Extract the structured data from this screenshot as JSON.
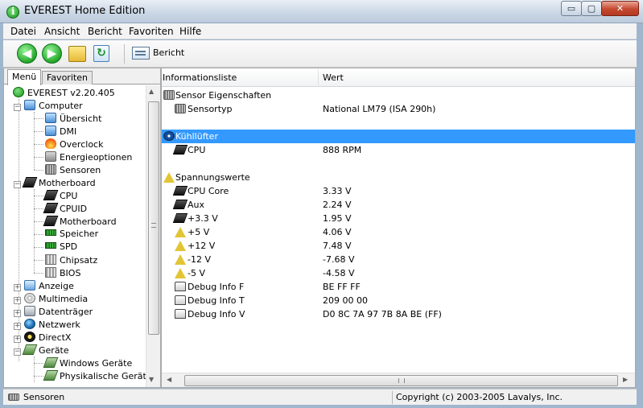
{
  "window": {
    "title": "EVEREST Home Edition",
    "min_glyph": "▭",
    "max_glyph": "▢",
    "close_glyph": "✕"
  },
  "menu": [
    "Datei",
    "Ansicht",
    "Bericht",
    "Favoriten",
    "Hilfe"
  ],
  "toolbar": {
    "back_glyph": "◀",
    "forward_glyph": "▶",
    "refresh_glyph": "↻",
    "report_label": "Bericht"
  },
  "left_tabs": [
    "Menü",
    "Favoriten"
  ],
  "tree": [
    {
      "label": "EVEREST v2.20.405",
      "icon": "everest-icon"
    },
    {
      "label": "Computer",
      "icon": "computer-icon"
    },
    {
      "label": "Übersicht",
      "icon": "computer-icon"
    },
    {
      "label": "DMI",
      "icon": "computer-icon"
    },
    {
      "label": "Overclock",
      "icon": "fire-icon"
    },
    {
      "label": "Energieoptionen",
      "icon": "power-icon"
    },
    {
      "label": "Sensoren",
      "icon": "sensor-icon"
    },
    {
      "label": "Motherboard",
      "icon": "motherboard-icon"
    },
    {
      "label": "CPU",
      "icon": "chip-icon"
    },
    {
      "label": "CPUID",
      "icon": "chip-icon"
    },
    {
      "label": "Motherboard",
      "icon": "motherboard-icon"
    },
    {
      "label": "Speicher",
      "icon": "ram-icon"
    },
    {
      "label": "SPD",
      "icon": "ram-icon"
    },
    {
      "label": "Chipsatz",
      "icon": "chipset-icon"
    },
    {
      "label": "BIOS",
      "icon": "chipset-icon"
    },
    {
      "label": "Anzeige",
      "icon": "display-icon"
    },
    {
      "label": "Multimedia",
      "icon": "multimedia-icon"
    },
    {
      "label": "Datenträger",
      "icon": "disk-icon"
    },
    {
      "label": "Netzwerk",
      "icon": "network-icon"
    },
    {
      "label": "DirectX",
      "icon": "directx-icon"
    },
    {
      "label": "Geräte",
      "icon": "device-icon"
    },
    {
      "label": "Windows Geräte",
      "icon": "device-icon"
    },
    {
      "label": "Physikalische Geräte",
      "icon": "device-icon"
    }
  ],
  "columns": [
    "Informationsliste",
    "Wert"
  ],
  "rows": [
    {
      "name": "Sensor Eigenschaften",
      "value": "",
      "icon": "sensor-icon"
    },
    {
      "name": "Sensortyp",
      "value": "National LM79  (ISA 290h)",
      "icon": "sensor-icon"
    },
    {
      "name": "Kühllüfter",
      "value": "",
      "icon": "fan-icon",
      "selected": true
    },
    {
      "name": "CPU",
      "value": "888 RPM",
      "icon": "chip-icon"
    },
    {
      "name": "Spannungswerte",
      "value": "",
      "icon": "warning-icon"
    },
    {
      "name": "CPU Core",
      "value": "3.33 V",
      "icon": "chip-icon"
    },
    {
      "name": "Aux",
      "value": "2.24 V",
      "icon": "chip-icon"
    },
    {
      "name": "+3.3 V",
      "value": "1.95 V",
      "icon": "chip-icon"
    },
    {
      "name": "+5 V",
      "value": "4.06 V",
      "icon": "warning-icon"
    },
    {
      "name": "+12 V",
      "value": "7.48 V",
      "icon": "warning-icon"
    },
    {
      "name": "-12 V",
      "value": "-7.68 V",
      "icon": "warning-icon"
    },
    {
      "name": "-5 V",
      "value": "-4.58 V",
      "icon": "warning-icon"
    },
    {
      "name": "Debug Info F",
      "value": "BE FF FF",
      "icon": "debug-icon"
    },
    {
      "name": "Debug Info T",
      "value": "209 00 00",
      "icon": "debug-icon"
    },
    {
      "name": "Debug Info V",
      "value": "D0 8C 7A 97 7B 8A BE  (FF)",
      "icon": "debug-icon"
    }
  ],
  "status": {
    "left": "Sensoren",
    "right": "Copyright (c) 2003-2005 Lavalys, Inc."
  },
  "colors": {
    "selection": "#3399ff",
    "close_button": "#c5482f"
  }
}
